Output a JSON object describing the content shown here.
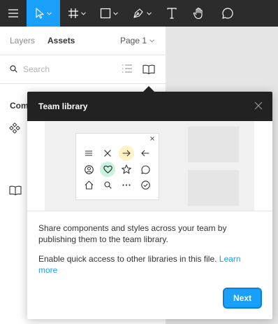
{
  "toolbar": {
    "items": [
      {
        "icon": "menu-icon"
      },
      {
        "icon": "move-pointer-icon",
        "active": true,
        "has_caret": true
      },
      {
        "icon": "frame-hash-icon",
        "has_caret": true
      },
      {
        "icon": "rectangle-icon",
        "has_caret": true
      },
      {
        "icon": "pen-icon",
        "has_caret": true
      },
      {
        "icon": "text-tool-icon"
      },
      {
        "icon": "hand-icon"
      },
      {
        "icon": "comment-icon"
      }
    ],
    "accent": "#18a0fb",
    "background": "#2c2c2c"
  },
  "panel": {
    "tabs": {
      "layers": "Layers",
      "assets": "Assets",
      "active": "assets"
    },
    "page_select": "Page 1",
    "search": {
      "placeholder": "Search",
      "value": ""
    },
    "section_label": "Com"
  },
  "popover": {
    "title": "Team library",
    "body_1": "Share components and styles across your team by publishing them to the team library.",
    "body_2_text": "Enable quick access to other libraries in this file. ",
    "body_2_link": "Learn more",
    "next_label": "Next",
    "illustration_icons": [
      "menu",
      "close-x",
      "arrow-right",
      "arrow-left",
      "user-circle",
      "heart",
      "star",
      "speech-bubble",
      "home",
      "search",
      "ellipsis",
      "check-circle"
    ]
  }
}
